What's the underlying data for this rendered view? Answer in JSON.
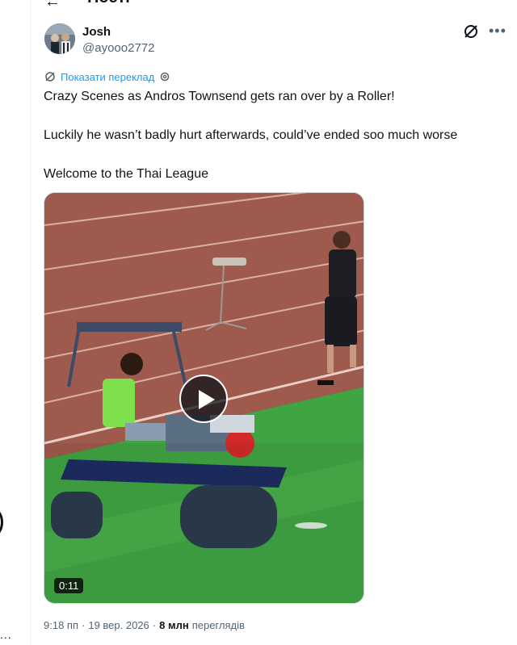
{
  "header": {
    "title": "Пості",
    "back_icon": "back-arrow-icon"
  },
  "author": {
    "display_name": "Josh",
    "handle": "@ayooo2772"
  },
  "translate": {
    "label": "Показати переклад"
  },
  "tweet": {
    "lines": [
      "Crazy Scenes as Andros Townsend gets ran over by a Roller!",
      "Luckily he wasn’t badly hurt afterwards, could’ve ended soo much worse",
      "Welcome to the Thai League"
    ]
  },
  "media": {
    "duration": "0:11",
    "play_icon": "play-icon"
  },
  "meta": {
    "time": "9:18 пп",
    "separator": "·",
    "date": "19 вер. 2026",
    "separator2": "·",
    "views": "8 млн",
    "views_label": "переглядів"
  },
  "left_panel": {
    "dots": "..."
  },
  "colors": {
    "accent": "#1d9bf0",
    "text": "#0f1419",
    "muted": "#536471",
    "track": "#a4574a",
    "grass": "#3fa442"
  }
}
